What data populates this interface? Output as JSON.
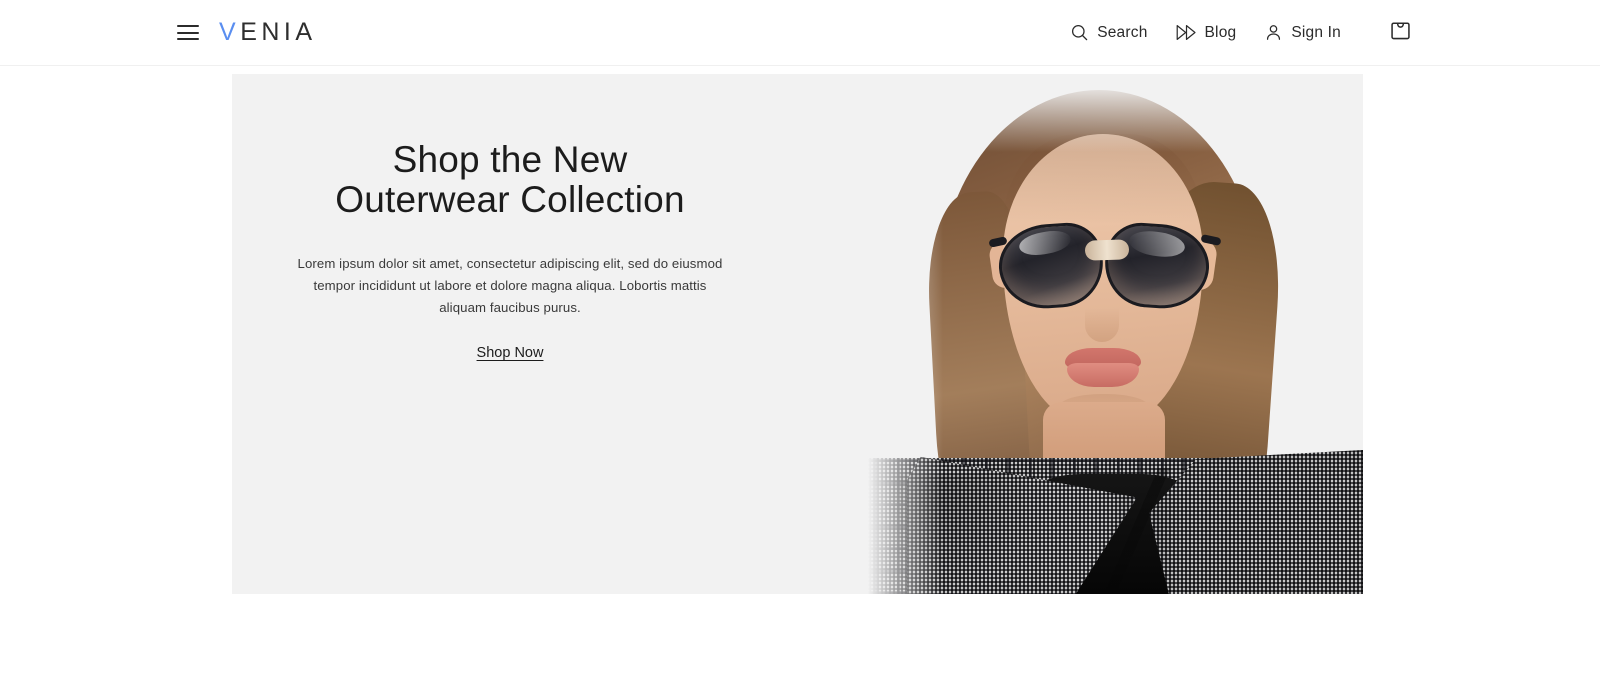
{
  "header": {
    "menu_icon": "hamburger-menu-icon",
    "logo": {
      "first_letter": "V",
      "rest": "ENIA",
      "full": "VENIA",
      "accent_color": "#5a8ef0",
      "text_color": "#2e2e2e"
    },
    "nav": [
      {
        "label": "Search",
        "icon": "search-icon"
      },
      {
        "label": "Blog",
        "icon": "fast-forward-icon"
      },
      {
        "label": "Sign In",
        "icon": "person-icon"
      }
    ],
    "cart": {
      "icon": "shopping-bag-icon",
      "label": ""
    }
  },
  "hero": {
    "title": "Shop the New\nOuterwear Collection",
    "body": "Lorem ipsum dolor sit amet, consectetur adipiscing elit, sed do eiusmod tempor incididunt ut labore et dolore magna aliqua. Lobortis mattis aliquam faucibus purus.",
    "cta": "Shop Now",
    "background_color": "#f2f2f2",
    "image_alt": "Model wearing sunglasses and a grey houndstooth plaid outerwear jacket over a black top"
  },
  "page": {
    "background_color": "#ffffff"
  }
}
